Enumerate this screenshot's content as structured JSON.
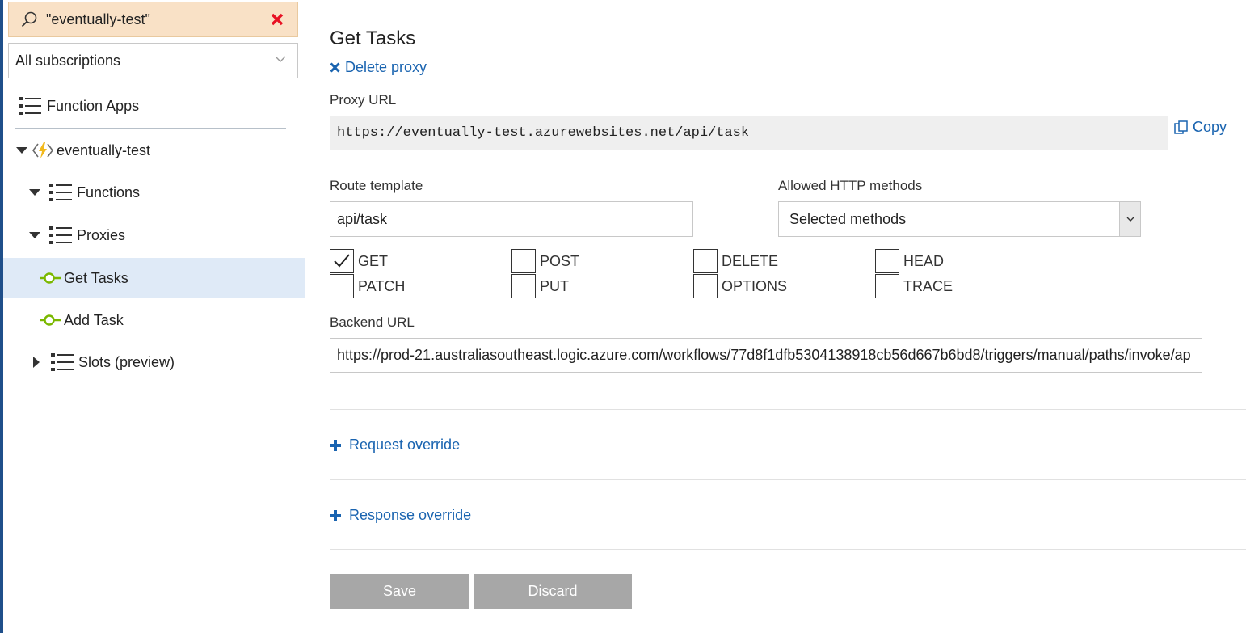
{
  "sidebar": {
    "search_value": "\"eventually-test\"",
    "subscription_filter": "All subscriptions",
    "tree": {
      "function_apps": "Function Apps",
      "app_name": "eventually-test",
      "functions": "Functions",
      "proxies": "Proxies",
      "proxy_items": [
        "Get Tasks",
        "Add Task"
      ],
      "slots": "Slots (preview)"
    }
  },
  "main": {
    "title": "Get Tasks",
    "delete_label": "Delete proxy",
    "proxy_url_label": "Proxy URL",
    "proxy_url": "https://eventually-test.azurewebsites.net/api/task",
    "copy_label": "Copy",
    "route_template_label": "Route template",
    "route_template": "api/task",
    "allowed_methods_label": "Allowed HTTP methods",
    "allowed_methods_value": "Selected methods",
    "methods": [
      {
        "label": "GET",
        "checked": true
      },
      {
        "label": "POST",
        "checked": false
      },
      {
        "label": "DELETE",
        "checked": false
      },
      {
        "label": "HEAD",
        "checked": false
      },
      {
        "label": "PATCH",
        "checked": false
      },
      {
        "label": "PUT",
        "checked": false
      },
      {
        "label": "OPTIONS",
        "checked": false
      },
      {
        "label": "TRACE",
        "checked": false
      }
    ],
    "backend_url_label": "Backend URL",
    "backend_url": "https://prod-21.australiasoutheast.logic.azure.com/workflows/77d8f1dfb5304138918cb56d667b6bd8/triggers/manual/paths/invoke/ap",
    "request_override": "Request override",
    "response_override": "Response override",
    "save_label": "Save",
    "discard_label": "Discard"
  },
  "colors": {
    "link": "#1a64b0",
    "search_bg": "#f9e1c6",
    "selected_bg": "#dfeaf7",
    "button_disabled": "#a7a7a7",
    "proxy_icon": "#7ab800"
  }
}
